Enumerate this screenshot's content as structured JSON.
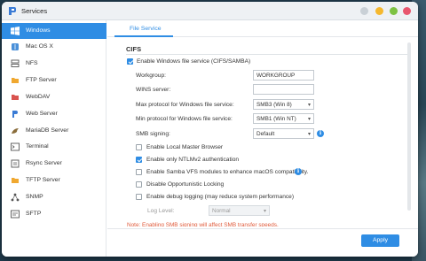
{
  "window": {
    "title": "Services"
  },
  "sidebar": {
    "items": [
      {
        "label": "Windows",
        "icon": "windows-icon",
        "active": true
      },
      {
        "label": "Mac OS X",
        "icon": "apple-icon"
      },
      {
        "label": "NFS",
        "icon": "nfs-icon"
      },
      {
        "label": "FTP Server",
        "icon": "ftp-icon"
      },
      {
        "label": "WebDAV",
        "icon": "webdav-icon"
      },
      {
        "label": "Web Server",
        "icon": "web-server-icon"
      },
      {
        "label": "MariaDB Server",
        "icon": "mariadb-icon"
      },
      {
        "label": "Terminal",
        "icon": "terminal-icon"
      },
      {
        "label": "Rsync Server",
        "icon": "rsync-icon"
      },
      {
        "label": "TFTP Server",
        "icon": "tftp-icon"
      },
      {
        "label": "SNMP",
        "icon": "snmp-icon"
      },
      {
        "label": "SFTP",
        "icon": "sftp-icon"
      }
    ]
  },
  "tabs": [
    {
      "label": "File Service",
      "active": true
    }
  ],
  "cifs": {
    "section_title": "CIFS",
    "enable_label": "Enable Windows file service (CIFS/SAMBA)",
    "enable_checked": true,
    "workgroup_label": "Workgroup:",
    "workgroup_value": "WORKGROUP",
    "wins_label": "WINS server:",
    "wins_value": "",
    "max_protocol_label": "Max protocol for Windows file service:",
    "max_protocol_value": "SMB3 (Win 8)",
    "min_protocol_label": "Min protocol for Windows file service:",
    "min_protocol_value": "SMB1 (Win NT)",
    "signing_label": "SMB signing:",
    "signing_value": "Default",
    "local_master_label": "Enable Local Master Browser",
    "local_master_checked": false,
    "ntlmv2_label": "Enable only NTLMv2 authentication",
    "ntlmv2_checked": true,
    "vfs_label": "Enable Samba VFS modules to enhance macOS compatibility.",
    "vfs_checked": false,
    "oplocks_label": "Disable Opportunistic Locking",
    "oplocks_checked": false,
    "debug_label": "Enable debug logging (may reduce system performance)",
    "debug_checked": false,
    "log_level_label": "Log Level:",
    "log_level_value": "Normal",
    "note": "Note: Enabling SMB signing will affect SMB transfer speeds."
  },
  "footer": {
    "apply_label": "Apply"
  },
  "colors": {
    "accent": "#2f8de4",
    "note": "#e05a3a",
    "sidebar_active": "#2f8de4"
  }
}
